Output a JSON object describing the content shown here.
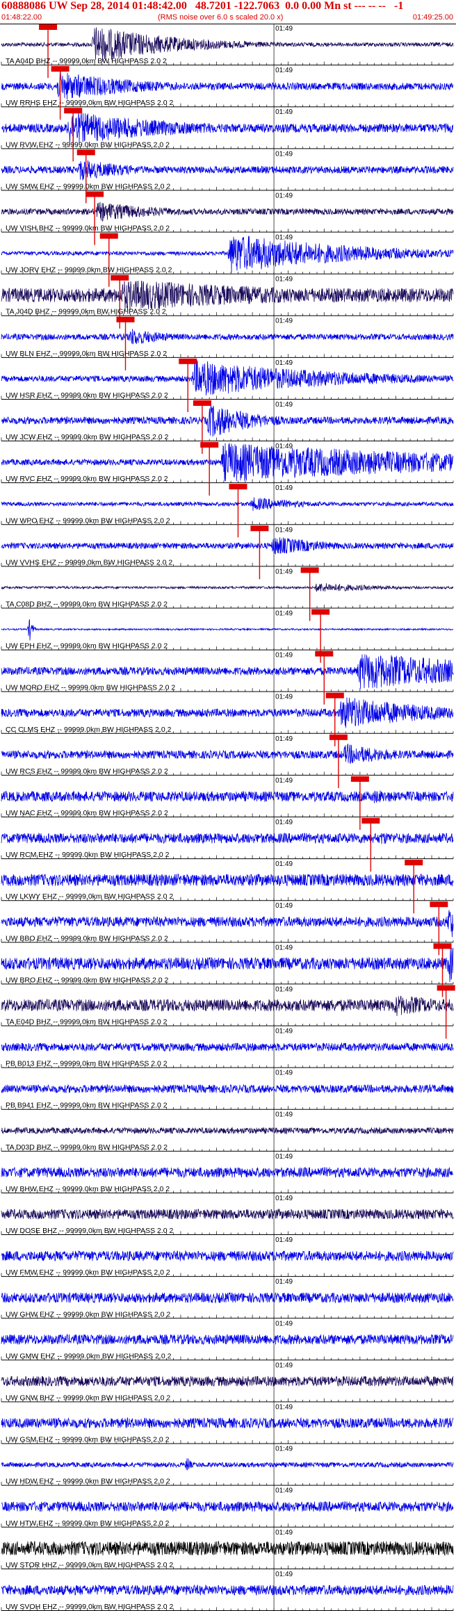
{
  "header": {
    "title": "60888086 UW Sep 28, 2014 01:48:42.00   48.7201 -122.7063  0.0 0.00 Mn st --- -- --   -1",
    "start_time": "01:48:22.00",
    "noise_note": "(RMS noise over 6.0 s scaled 20.0 x)",
    "end_time": "01:49:25.00"
  },
  "chart_data": {
    "type": "line",
    "title": "60888086 UW Sep 28, 2014 01:48:42.00   48.7201 -122.7063  0.0 0.00 Mn st --- -- --   -1",
    "x_start": "01:48:22.00",
    "x_end": "01:49:25.00",
    "time_span_s": 63,
    "minute_label": "01:49",
    "minute_mark_s": 38,
    "grid": true,
    "colors": {
      "blue": "#0000e6",
      "navy": "#1a0a5a",
      "black": "#000000",
      "pick": "#e00000",
      "axis": "#000000"
    },
    "traces": [
      {
        "label": "TA A04D BHZ -- 99999.0km BW  HIGHPASS  2.0  2",
        "color": "navy",
        "base": 0.1,
        "event_s": 13,
        "event_amp": 0.95,
        "event_dur": 12,
        "pick_s": 6.5
      },
      {
        "label": "UW RRHS EHZ -- 99999.0km BW  HIGHPASS  2.0  2",
        "color": "blue",
        "base": 0.18,
        "event_s": 8,
        "event_amp": 0.75,
        "event_dur": 12,
        "pick_s": 8.2
      },
      {
        "label": "UW RVW EHZ -- 99999.0km BW  HIGHPASS  2.0  2",
        "color": "blue",
        "base": 0.22,
        "event_s": 9.5,
        "event_amp": 0.85,
        "event_dur": 16,
        "pick_s": 10.0
      },
      {
        "label": "UW SMW EHZ -- 99999.0km BW  HIGHPASS  2.0  2",
        "color": "blue",
        "base": 0.18,
        "event_s": 11,
        "event_amp": 0.55,
        "event_dur": 8,
        "pick_s": 11.8
      },
      {
        "label": "UW VISH BHZ -- 99999.0km BW  HIGHPASS  2.0  2",
        "color": "navy",
        "base": 0.15,
        "event_s": 13.5,
        "event_amp": 0.5,
        "event_dur": 10,
        "pick_s": 13.0
      },
      {
        "label": "UW JORV EHZ -- 99999.0km BW  HIGHPASS  2.0  2",
        "color": "blue",
        "base": 0.1,
        "event_s": 32,
        "event_amp": 1.0,
        "event_dur": 18,
        "pick_s": 15.0
      },
      {
        "label": "TA J04D BHZ -- 99999.0km BW  HIGHPASS  2.0  2",
        "color": "navy",
        "base": 0.35,
        "event_s": 17,
        "event_amp": 0.8,
        "event_dur": 30,
        "pick_s": 16.5
      },
      {
        "label": "UW BLN EHZ -- 99999.0km BW  HIGHPASS  2.0  2",
        "color": "blue",
        "base": 0.15,
        "event_s": 18,
        "event_amp": 0.45,
        "event_dur": 6,
        "pick_s": 17.3
      },
      {
        "label": "UW HSR EHZ -- 99999.0km BW  HIGHPASS  2.0  2",
        "color": "blue",
        "base": 0.15,
        "event_s": 27,
        "event_amp": 0.95,
        "event_dur": 20,
        "pick_s": 26.0
      },
      {
        "label": "UW JCW EHZ -- 99999.0km BW  HIGHPASS  2.0  2",
        "color": "blue",
        "base": 0.18,
        "event_s": 29,
        "event_amp": 0.9,
        "event_dur": 7,
        "pick_s": 28.0
      },
      {
        "label": "UW RVC EHZ -- 99999.0km BW  HIGHPASS  2.0  2",
        "color": "blue",
        "base": 0.15,
        "event_s": 31,
        "event_amp": 1.0,
        "event_dur": 40,
        "pick_s": 29.0
      },
      {
        "label": "UW WPO EHZ -- 99999.0km BW  HIGHPASS  2.0  2",
        "color": "blue",
        "base": 0.1,
        "event_s": 35,
        "event_amp": 0.35,
        "event_dur": 8,
        "pick_s": 33.0
      },
      {
        "label": "UW VVHS EHZ -- 99999.0km BW  HIGHPASS  2.0  2",
        "color": "blue",
        "base": 0.15,
        "event_s": 38,
        "event_amp": 0.5,
        "event_dur": 8,
        "pick_s": 36.0
      },
      {
        "label": "TA C08D BHZ -- 99999.0km BW  HIGHPASS  2.0  2",
        "color": "navy",
        "base": 0.06,
        "event_s": 44,
        "event_amp": 0.25,
        "event_dur": 10,
        "pick_s": 43.0
      },
      {
        "label": "UW EPH EHZ -- 99999.0km BW  HIGHPASS  2.0  2",
        "color": "blue",
        "base": 0.04,
        "event_s": 4,
        "event_amp": 0.6,
        "event_dur": 0.4,
        "pick_s": 44.5
      },
      {
        "label": "UW MORO EHZ -- 99999.0km BW  HIGHPASS  2.0  2",
        "color": "blue",
        "base": 0.2,
        "event_s": 50,
        "event_amp": 0.95,
        "event_dur": 25,
        "pick_s": 45.0
      },
      {
        "label": "CC CLMS EHZ -- 99999.0km BW  HIGHPASS  2.0  2",
        "color": "blue",
        "base": 0.2,
        "event_s": 47.5,
        "event_amp": 0.85,
        "event_dur": 14,
        "pick_s": 46.5
      },
      {
        "label": "UW RCS EHZ -- 99999.0km BW  HIGHPASS  2.0  2",
        "color": "blue",
        "base": 0.2,
        "event_s": 48,
        "event_amp": 0.55,
        "event_dur": 8,
        "pick_s": 47.0
      },
      {
        "label": "UW NAC EHZ -- 99999.0km BW  HIGHPASS  2.0  2",
        "color": "blue",
        "base": 0.25,
        "event_s": 52,
        "event_amp": 0.35,
        "event_dur": 8,
        "pick_s": 50.0
      },
      {
        "label": "UW RCM EHZ -- 99999.0km BW  HIGHPASS  2.0  2",
        "color": "blue",
        "base": 0.25,
        "event_s": 53,
        "event_amp": 0.35,
        "event_dur": 4,
        "pick_s": 51.5
      },
      {
        "label": "UW LKWY EHZ -- 99999.0km BW  HIGHPASS  2.0  2",
        "color": "blue",
        "base": 0.3,
        "event_s": 59,
        "event_amp": 0.35,
        "event_dur": 6,
        "pick_s": 57.5
      },
      {
        "label": "UW BBO EHZ -- 99999.0km BW  HIGHPASS  2.0  2",
        "color": "blue",
        "base": 0.25,
        "event_s": 62.5,
        "event_amp": 0.9,
        "event_dur": 3,
        "pick_s": 61.0
      },
      {
        "label": "UW BRO EHZ -- 99999.0km BW  HIGHPASS  2.0  2",
        "color": "blue",
        "base": 0.3,
        "event_s": 62.5,
        "event_amp": 0.95,
        "event_dur": 3,
        "pick_s": 61.5
      },
      {
        "label": "TA E04D BHZ -- 99999.0km BW  HIGHPASS  2.0  2",
        "color": "navy",
        "base": 0.3,
        "event_s": 55,
        "event_amp": 0.55,
        "event_dur": 10,
        "pick_s": 62.0
      },
      {
        "label": "PB B013 EHZ -- 99999.0km BW  HIGHPASS  2.0  2",
        "color": "blue",
        "base": 0.2,
        "event_s": 0,
        "event_amp": 0,
        "event_dur": 0,
        "pick_s": null
      },
      {
        "label": "PB B941 EHZ -- 99999.0km BW  HIGHPASS  2.0  2",
        "color": "blue",
        "base": 0.2,
        "event_s": 0,
        "event_amp": 0,
        "event_dur": 0,
        "pick_s": null
      },
      {
        "label": "TA D03D BHZ -- 99999.0km BW  HIGHPASS  2.0  2",
        "color": "navy",
        "base": 0.15,
        "event_s": 0,
        "event_amp": 0,
        "event_dur": 0,
        "pick_s": null
      },
      {
        "label": "UW BHW EHZ -- 99999.0km BW  HIGHPASS  2.0  2",
        "color": "blue",
        "base": 0.25,
        "event_s": 0,
        "event_amp": 0,
        "event_dur": 0,
        "pick_s": null
      },
      {
        "label": "UW DOSE BHZ -- 99999.0km BW  HIGHPASS  2.0  2",
        "color": "navy",
        "base": 0.25,
        "event_s": 0,
        "event_amp": 0,
        "event_dur": 0,
        "pick_s": null
      },
      {
        "label": "UW FMW EHZ -- 99999.0km BW  HIGHPASS  2.0  2",
        "color": "blue",
        "base": 0.25,
        "event_s": 0,
        "event_amp": 0,
        "event_dur": 0,
        "pick_s": null
      },
      {
        "label": "UW GHW EHZ -- 99999.0km BW  HIGHPASS  2.0  2",
        "color": "blue",
        "base": 0.25,
        "event_s": 0,
        "event_amp": 0,
        "event_dur": 0,
        "pick_s": null
      },
      {
        "label": "UW GMW EHZ -- 99999.0km BW  HIGHPASS  2.0  2",
        "color": "blue",
        "base": 0.25,
        "event_s": 0,
        "event_amp": 0,
        "event_dur": 0,
        "pick_s": null
      },
      {
        "label": "UW GNW BHZ -- 99999.0km BW  HIGHPASS  2.0  2",
        "color": "navy",
        "base": 0.25,
        "event_s": 0,
        "event_amp": 0,
        "event_dur": 0,
        "pick_s": null
      },
      {
        "label": "UW GSM EHZ -- 99999.0km BW  HIGHPASS  2.0  2",
        "color": "blue",
        "base": 0.25,
        "event_s": 0,
        "event_amp": 0,
        "event_dur": 0,
        "pick_s": null
      },
      {
        "label": "UW HDW EHZ -- 99999.0km BW  HIGHPASS  2.0  2",
        "color": "blue",
        "base": 0.12,
        "event_s": 26,
        "event_amp": 0.5,
        "event_dur": 0.4,
        "pick_s": null
      },
      {
        "label": "UW HTW EHZ -- 99999.0km BW  HIGHPASS  2.0  2",
        "color": "blue",
        "base": 0.25,
        "event_s": 0,
        "event_amp": 0,
        "event_dur": 0,
        "pick_s": null
      },
      {
        "label": "UW STOR HHZ -- 99999.0km BW  HIGHPASS  2.0  2",
        "color": "black",
        "base": 0.35,
        "event_s": 0,
        "event_amp": 0,
        "event_dur": 0,
        "pick_s": null
      },
      {
        "label": "UW SVOH EHZ -- 99999.0km BW  HIGHPASS  2.0  2",
        "color": "blue",
        "base": 0.25,
        "event_s": 0,
        "event_amp": 0,
        "event_dur": 0,
        "pick_s": null
      }
    ]
  }
}
